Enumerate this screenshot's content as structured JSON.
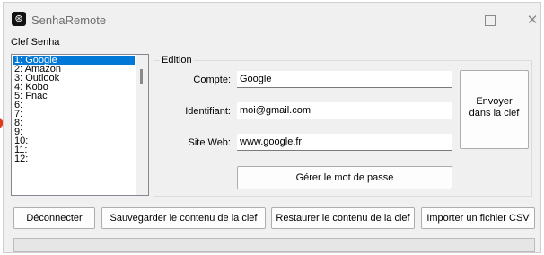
{
  "window": {
    "title": "SenhaRemote",
    "minimize": "—",
    "close": "✕"
  },
  "clef": {
    "group_title": "Clef Senha",
    "items": [
      "1: Google",
      "2: Amazon",
      "3: Outlook",
      "4: Kobo",
      "5: Fnac",
      "6:",
      "7:",
      "8:",
      "9:",
      "10:",
      "11:",
      "12:"
    ],
    "selected_index": 0
  },
  "edition": {
    "group_title": "Edition",
    "compte_label": "Compte:",
    "compte_value": "Google",
    "identifiant_label": "Identifiant:",
    "identifiant_value": "moi@gmail.com",
    "site_label": "Site Web:",
    "site_value": "www.google.fr",
    "gerer_button": "Gérer le mot de passe",
    "envoyer_line1": "Envoyer",
    "envoyer_line2": "dans la clef"
  },
  "actions": {
    "deconnecter": "Déconnecter",
    "sauvegarder": "Sauvegarder le contenu de la clef",
    "restaurer": "Restaurer le contenu de la clef",
    "importer": "Importer un fichier CSV"
  },
  "colors": {
    "selection": "#0078d7",
    "pointer_arrow": "#e23b1c"
  }
}
